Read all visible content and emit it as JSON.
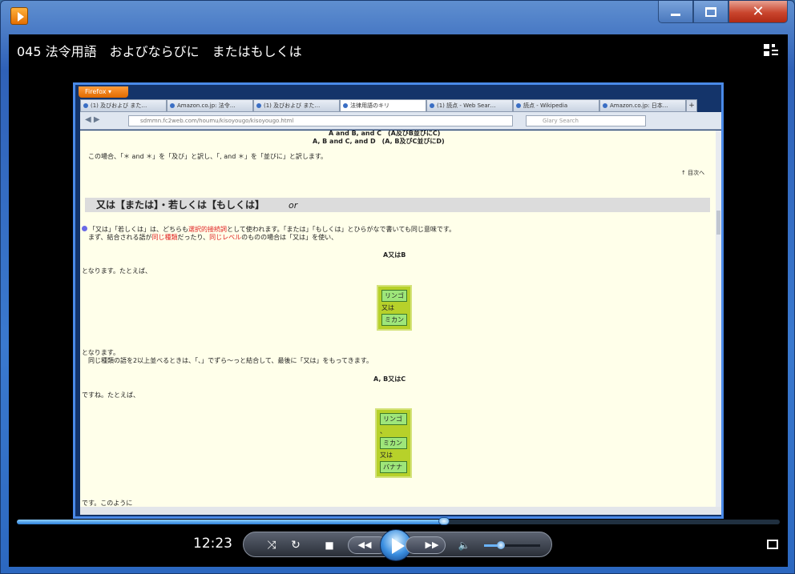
{
  "window": {
    "title_icon": "media-player-icon"
  },
  "caption": {
    "minimize": "—",
    "maximize": "□",
    "close": "✕"
  },
  "video": {
    "title": "045 法令用語　およびならびに　またはもしくは",
    "browser": {
      "menu_button": "Firefox ▾",
      "tabs": [
        "(1) 及びおよび また…",
        "Amazon.co.jp: 法令…",
        "(1) 及びおよび また…",
        "法律用語のキリ",
        "(1) 読点 - Web Sear…",
        "読点 - Wikipedia",
        "Amazon.co.jp: 日本…"
      ],
      "tab_add": "+",
      "url": "sdmmn.fc2web.com/houmu/kisoyougo/kisoyougo.html",
      "search_placeholder": "Glary Search",
      "page": {
        "top_line1": "A and B, and C　(A及びB並びにC)",
        "top_line2": "A, B and C, and D　(A, B及びC並びにD)",
        "note1": "この場合、「＊ and ＊」を「及び」と訳し、「, and ＊」を「並びに」と訳します。",
        "back_link": "↑ 目次へ",
        "heading": "又は【または】・若しくは【もしくは】",
        "heading_en": "or",
        "para1a": "「又は」「若しくは」は、どちらも",
        "para1_red": "選択的接続詞",
        "para1b": "として使われます。「または」「もしくは」とひらがなで書いても同じ意味です。",
        "para2a": "まず、結合される語が",
        "para2_red1": "同じ種類",
        "para2b": "だったり、",
        "para2_red2": "同じレベル",
        "para2c": "のものの場合は「又は」を使い、",
        "example1": "A又はB",
        "lead1": "となります。たとえば、",
        "box1": [
          "リンゴ",
          "又は",
          "ミカン"
        ],
        "lead2": "となります。",
        "para3": "同じ種類の語を2以上並べるときは、「、」でずら〜っと結合して、最後に「又は」をもってきます。",
        "example2": "A, B又はC",
        "lead3": "ですね。たとえば、",
        "box2": [
          "リンゴ",
          "、",
          "ミカン",
          "又は",
          "バナナ"
        ],
        "lead4": "です。このように"
      }
    }
  },
  "controls": {
    "time": "12:23",
    "seek_fraction": 0.56,
    "volume_fraction": 0.3,
    "shuffle": "⤨",
    "repeat": "↻",
    "stop": "■",
    "prev": "◀◀",
    "next": "▶▶",
    "mute": "🔈"
  }
}
